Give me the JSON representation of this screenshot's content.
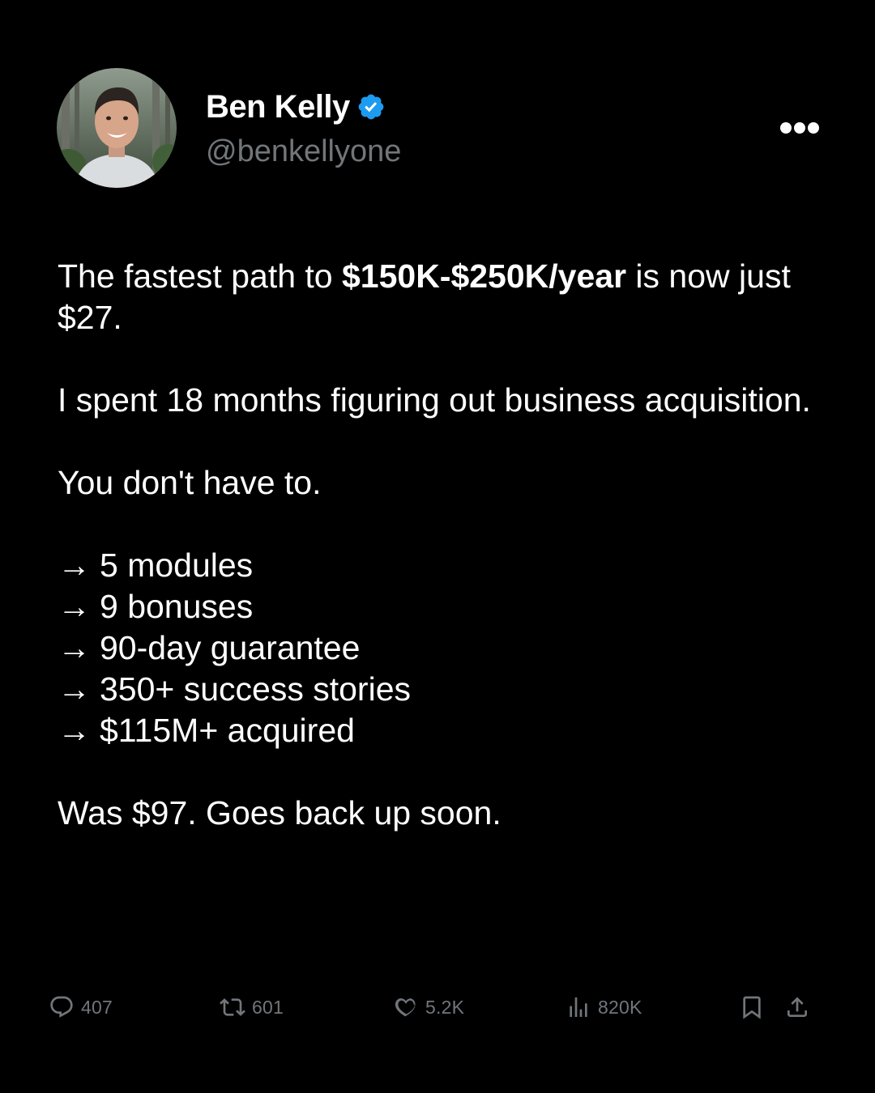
{
  "author": {
    "display_name": "Ben Kelly",
    "handle": "@benkellyone",
    "verified_icon": "verified-badge-icon",
    "verified_color": "#1d9bf0"
  },
  "tweet": {
    "line1_pre": "The fastest path to ",
    "line1_bold": "$150K-$250K/year",
    "line1_post": " is now just $27.",
    "para2": "I spent 18 months figuring out business acquisition.",
    "para3": "You don't have to.",
    "bullet_arrow": "→",
    "bullets": [
      "5 modules",
      "9 bonuses",
      "90-day guarantee",
      "350+ success stories",
      "$115M+ acquired"
    ],
    "closing": "Was $97. Goes back up soon."
  },
  "metrics": {
    "replies": "407",
    "reposts": "601",
    "likes": "5.2K",
    "views": "820K"
  },
  "icons": {
    "more": "more-dots-icon",
    "reply": "reply-icon",
    "repost": "repost-icon",
    "like": "heart-icon",
    "views": "views-icon",
    "bookmark": "bookmark-icon",
    "share": "share-icon"
  },
  "colors": {
    "background": "#000000",
    "text": "#ffffff",
    "muted": "#71767b",
    "accent": "#1d9bf0"
  }
}
